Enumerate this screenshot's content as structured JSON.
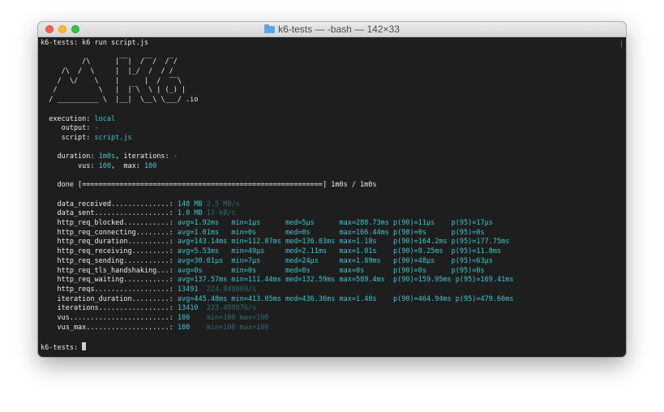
{
  "window": {
    "title": "k6-tests — -bash — 142×33",
    "folder_icon": "folder-icon"
  },
  "terminal": {
    "prompt_line": "k6-tests: k6 run script.js",
    "logo": [
      "",
      "          /\\      |‾‾|  /‾‾/  /‾/",
      "     /\\  /  \\     |  |_/  /  / /",
      "    /  \\/    \\    |      |  /  ‾‾\\",
      "   /          \\   |  |‾\\  \\ | (_) |",
      "  / __________ \\  |__|  \\__\\ \\___/ .io"
    ],
    "execution": {
      "label": "  execution: ",
      "value": "local"
    },
    "output": {
      "label": "     output: ",
      "value": "-"
    },
    "script": {
      "label": "     script: ",
      "value": "script.js"
    },
    "duration": {
      "l1": "    duration: ",
      "v1": "1m0s",
      "l2": ", iterations: ",
      "v2": "-"
    },
    "vus": {
      "l1": "         vus: ",
      "v1": "100",
      "l2": ",  max: ",
      "v2": "100"
    },
    "done": {
      "label": "    done [",
      "bar": "==========================================================",
      "suffix": "] 1m0s / 1m0s"
    },
    "metrics": [
      {
        "name": "    data_received",
        "dots": "..............: ",
        "value": "148 MB",
        "extra": " 2.5 MB/s"
      },
      {
        "name": "    data_sent",
        "dots": "..................: ",
        "value": "1.0 MB",
        "extra": " 17 kB/s"
      },
      {
        "name": "    http_req_blocked",
        "dots": "...........: ",
        "avg": "avg=1.92ms  ",
        "min": " min=1µs     ",
        "med": " med=5µs     ",
        "max": " max=288.73ms",
        "p90": " p(90)=11µs   ",
        "p95": " p(95)=17µs"
      },
      {
        "name": "    http_req_connecting",
        "dots": "........: ",
        "avg": "avg=1.01ms  ",
        "min": " min=0s      ",
        "med": " med=0s      ",
        "max": " max=166.44ms",
        "p90": " p(90)=0s     ",
        "p95": " p(95)=0s"
      },
      {
        "name": "    http_req_duration",
        "dots": "..........: ",
        "avg": "avg=143.14ms",
        "min": " min=112.87ms",
        "med": " med=136.03ms",
        "max": " max=1.18s   ",
        "p90": " p(90)=164.2ms",
        "p95": " p(95)=177.75ms"
      },
      {
        "name": "    http_req_receiving",
        "dots": ".........: ",
        "avg": "avg=5.53ms  ",
        "min": " min=49µs    ",
        "med": " med=2.11ms  ",
        "max": " max=1.01s   ",
        "p90": " p(90)=9.25ms ",
        "p95": " p(95)=11.8ms"
      },
      {
        "name": "    http_req_sending",
        "dots": "...........: ",
        "avg": "avg=30.01µs ",
        "min": " min=7µs     ",
        "med": " med=24µs    ",
        "max": " max=1.89ms  ",
        "p90": " p(90)=48µs   ",
        "p95": " p(95)=63µs"
      },
      {
        "name": "    http_req_tls_handshaking",
        "dots": "...: ",
        "avg": "avg=0s      ",
        "min": " min=0s      ",
        "med": " med=0s      ",
        "max": " max=0s      ",
        "p90": " p(90)=0s     ",
        "p95": " p(95)=0s"
      },
      {
        "name": "    http_req_waiting",
        "dots": "...........: ",
        "avg": "avg=137.57ms",
        "min": " min=111.44ms",
        "med": " med=132.59ms",
        "max": " max=589.4ms ",
        "p90": " p(90)=159.95ms",
        "p95": " p(95)=169.41ms"
      },
      {
        "name": "    http_reqs",
        "dots": "..................: ",
        "value": "13491",
        "extra": "  224.848869/s"
      },
      {
        "name": "    iteration_duration",
        "dots": ".........: ",
        "avg": "avg=445.48ms",
        "min": " min=413.05ms",
        "med": " med=436.36ms",
        "max": " max=1.48s   ",
        "p90": " p(90)=464.94ms",
        "p95": " p(95)=479.66ms"
      },
      {
        "name": "    iterations",
        "dots": ".................: ",
        "value": "13410",
        "extra": "  223.498876/s"
      },
      {
        "name": "    vus",
        "dots": "........................: ",
        "value": "100",
        "extra": "    min=100 max=100"
      },
      {
        "name": "    vus_max",
        "dots": "....................: ",
        "value": "100",
        "extra": "    min=100 max=100"
      }
    ],
    "final_prompt": "k6-tests: "
  }
}
